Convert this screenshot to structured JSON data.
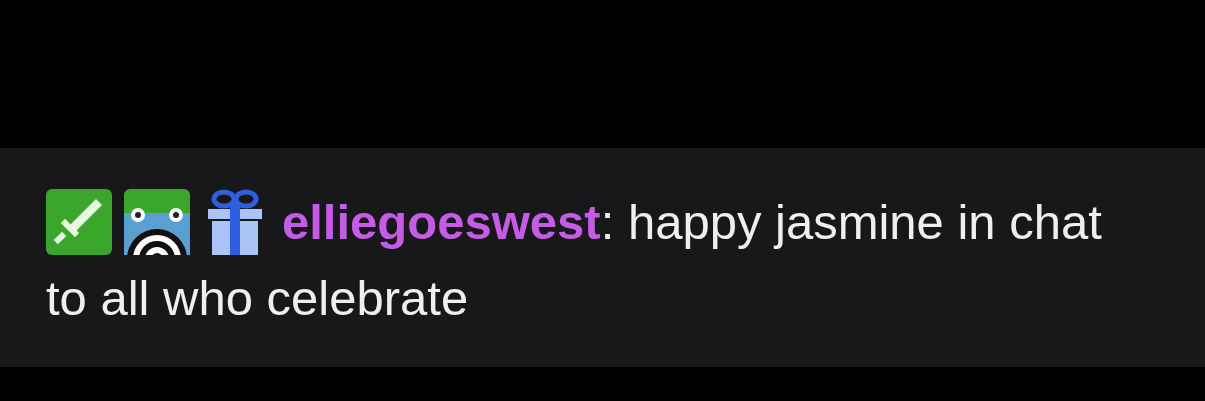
{
  "message": {
    "badges": [
      {
        "kind": "sword"
      },
      {
        "kind": "frog"
      },
      {
        "kind": "gift"
      }
    ],
    "username": "elliegoeswest",
    "color": "#c45ce6",
    "separator": ":",
    "lines": [
      "happy jasmine in chat",
      "to all who celebrate"
    ]
  }
}
